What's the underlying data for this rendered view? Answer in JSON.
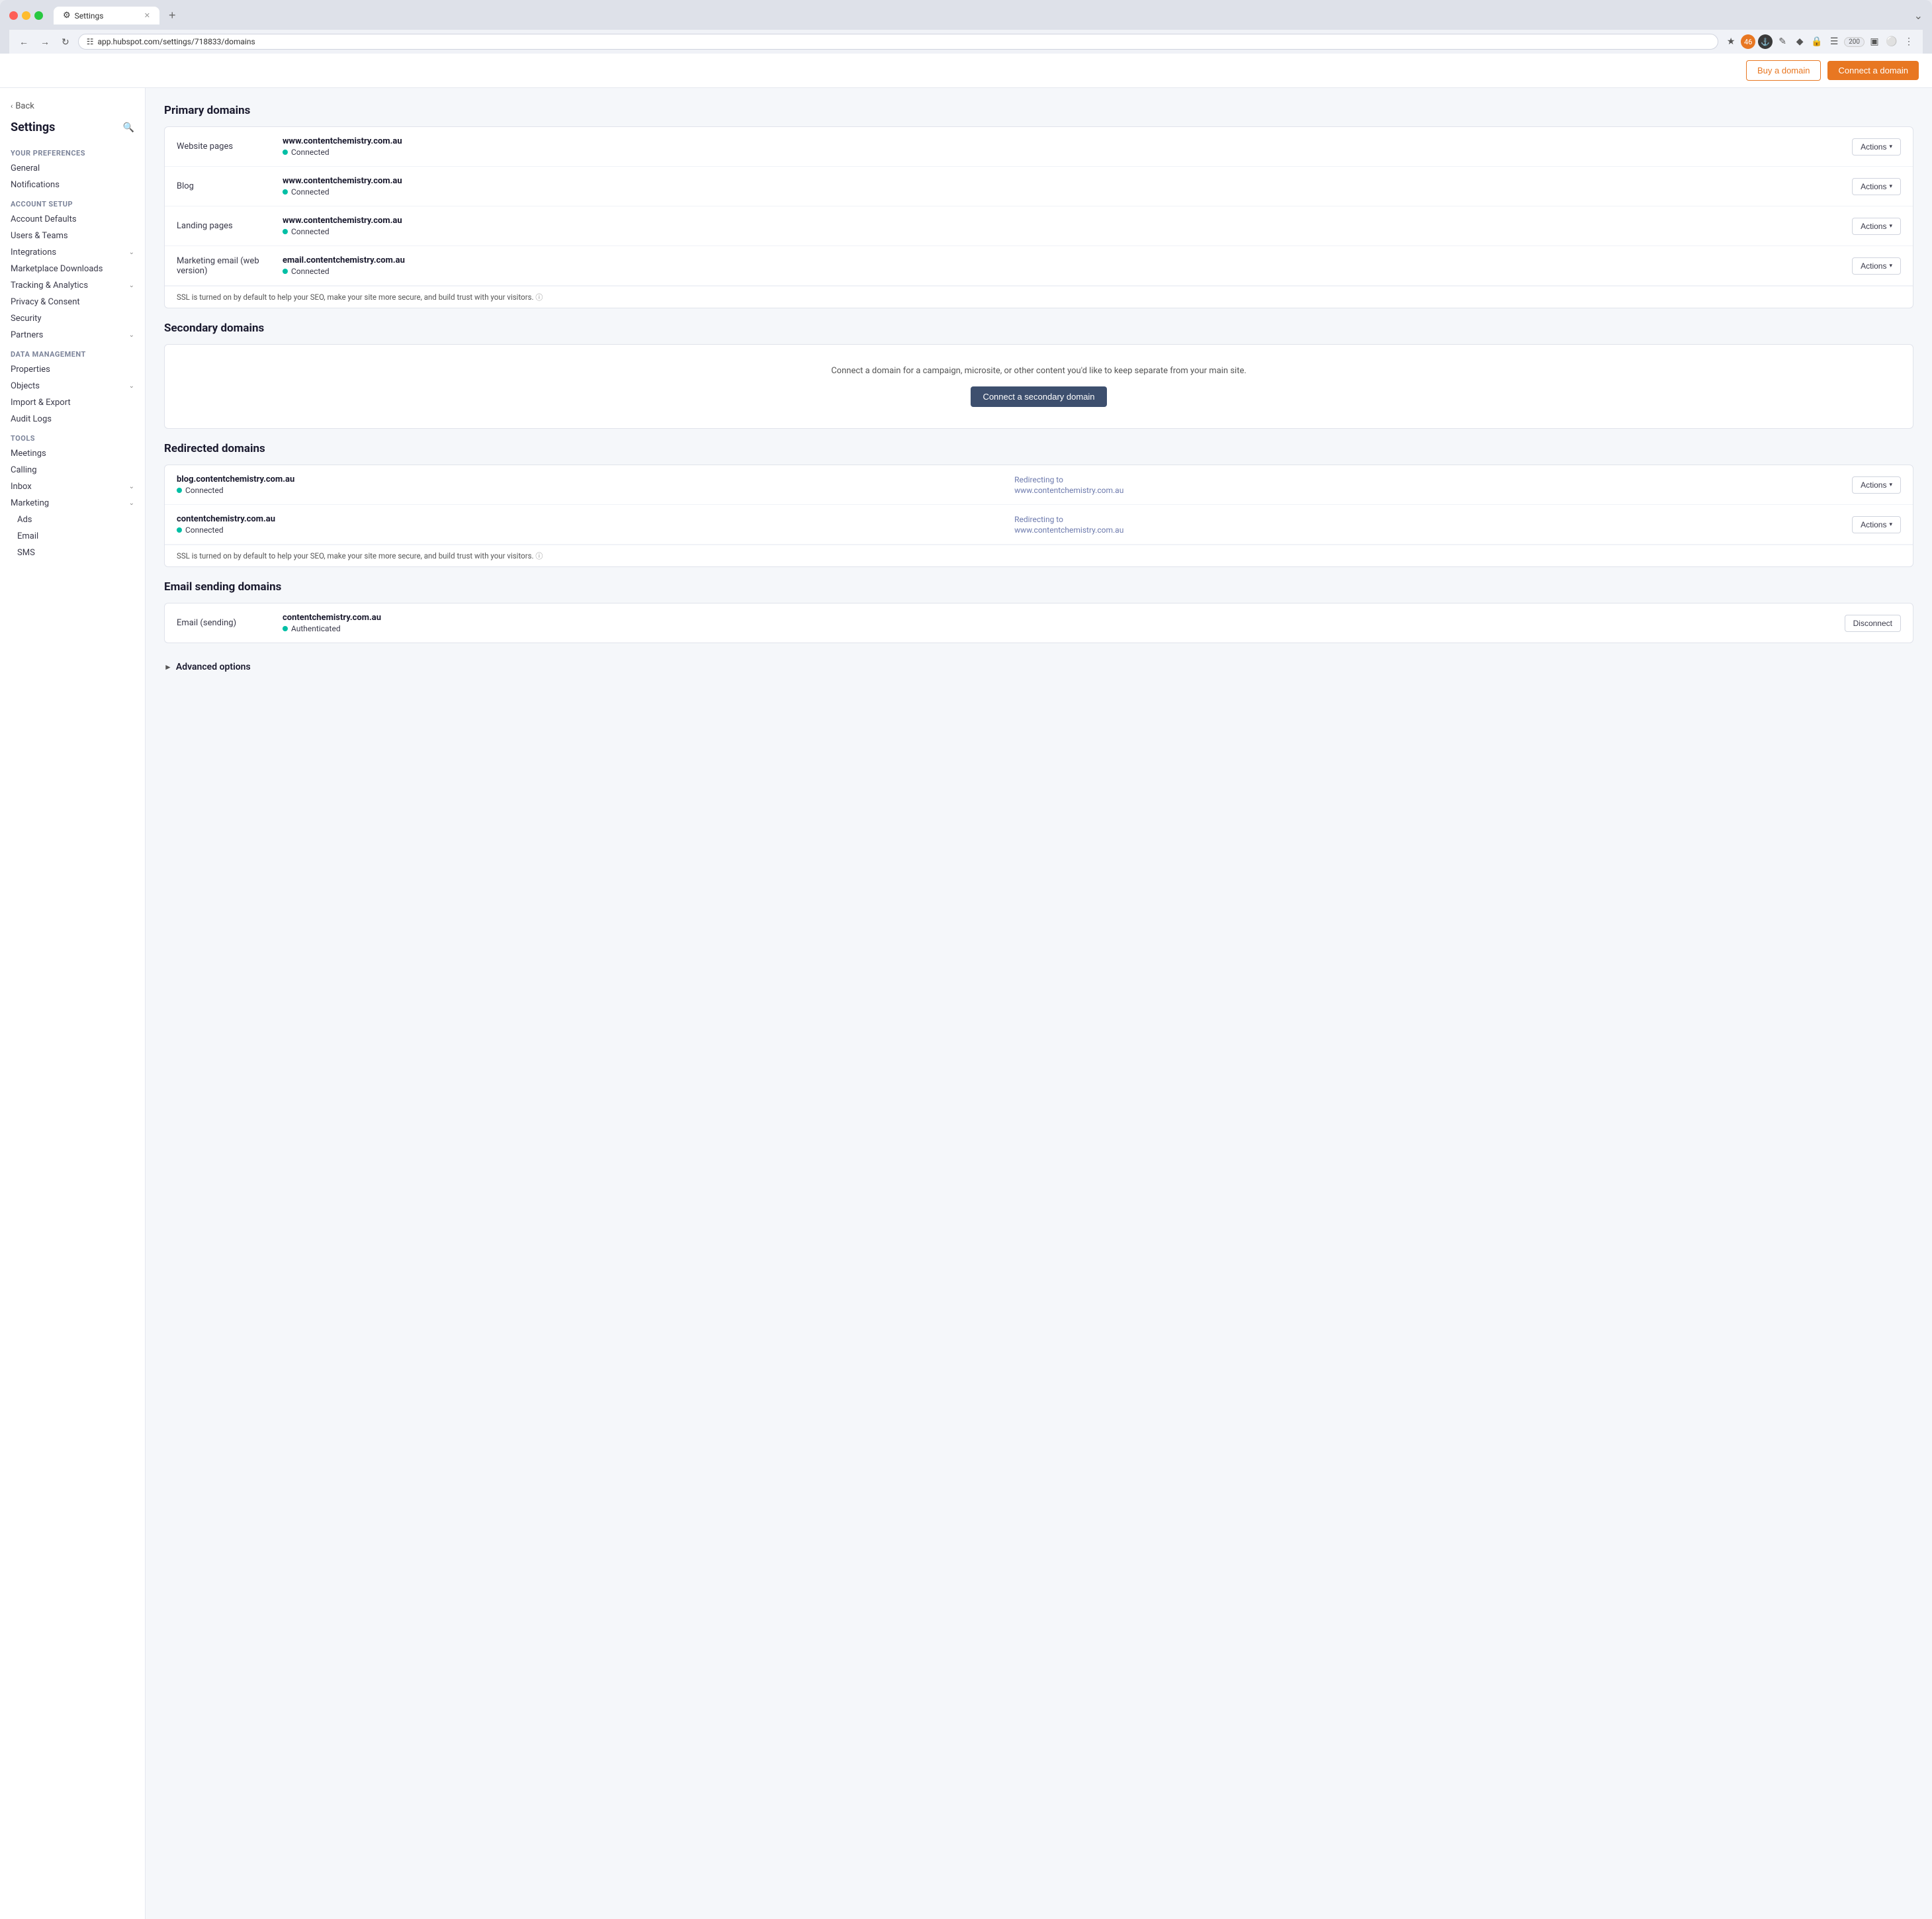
{
  "browser": {
    "tab_label": "Settings",
    "tab_favicon": "⚙",
    "url": "app.hubspot.com/settings/718833/domains",
    "new_tab_icon": "+",
    "close_icon": "✕",
    "chevron_down": "⌄"
  },
  "header": {
    "buy_domain_label": "Buy a domain",
    "connect_domain_label": "Connect a domain"
  },
  "sidebar": {
    "back_label": "Back",
    "title": "Settings",
    "sections": [
      {
        "label": "Your Preferences",
        "items": [
          {
            "label": "General",
            "sub": false
          },
          {
            "label": "Notifications",
            "sub": false
          }
        ]
      },
      {
        "label": "Account Setup",
        "items": [
          {
            "label": "Account Defaults",
            "sub": false
          },
          {
            "label": "Users & Teams",
            "sub": false
          },
          {
            "label": "Integrations",
            "sub": false,
            "caret": true
          },
          {
            "label": "Marketplace Downloads",
            "sub": false
          },
          {
            "label": "Tracking & Analytics",
            "sub": false,
            "caret": true
          },
          {
            "label": "Privacy & Consent",
            "sub": false
          },
          {
            "label": "Security",
            "sub": false
          },
          {
            "label": "Partners",
            "sub": false,
            "caret": true
          }
        ]
      },
      {
        "label": "Data Management",
        "items": [
          {
            "label": "Properties",
            "sub": false
          },
          {
            "label": "Objects",
            "sub": false,
            "caret": true
          },
          {
            "label": "Import & Export",
            "sub": false
          },
          {
            "label": "Audit Logs",
            "sub": false
          }
        ]
      },
      {
        "label": "Tools",
        "items": [
          {
            "label": "Meetings",
            "sub": false
          },
          {
            "label": "Calling",
            "sub": false
          },
          {
            "label": "Inbox",
            "sub": false,
            "caret": true
          },
          {
            "label": "Marketing",
            "sub": false,
            "caret": true
          },
          {
            "label": "Ads",
            "sub": true
          },
          {
            "label": "Email",
            "sub": true
          },
          {
            "label": "SMS",
            "sub": true
          }
        ]
      }
    ]
  },
  "main": {
    "primary_domains": {
      "section_title": "Primary domains",
      "rows": [
        {
          "type": "Website pages",
          "domain": "www.contentchemistry.com.au",
          "status": "Connected",
          "actions_label": "Actions"
        },
        {
          "type": "Blog",
          "domain": "www.contentchemistry.com.au",
          "status": "Connected",
          "actions_label": "Actions"
        },
        {
          "type": "Landing pages",
          "domain": "www.contentchemistry.com.au",
          "status": "Connected",
          "actions_label": "Actions"
        },
        {
          "type": "Marketing email (web version)",
          "domain": "email.contentchemistry.com.au",
          "status": "Connected",
          "actions_label": "Actions"
        }
      ],
      "ssl_notice": "SSL is turned on by default to help your SEO, make your site more secure, and build trust with your visitors."
    },
    "secondary_domains": {
      "section_title": "Secondary domains",
      "empty_message": "Connect a domain for a campaign, microsite, or other content you'd like to keep separate from your main site.",
      "connect_button_label": "Connect a secondary domain"
    },
    "redirected_domains": {
      "section_title": "Redirected domains",
      "rows": [
        {
          "domain": "blog.contentchemistry.com.au",
          "status": "Connected",
          "redirect_label": "Redirecting to",
          "redirect_url": "www.contentchemistry.-\ncom.au",
          "actions_label": "Actions"
        },
        {
          "domain": "contentchemistry.com.au",
          "status": "Connected",
          "redirect_label": "Redirecting to",
          "redirect_url": "www.contentchemistry.-\ncom.au",
          "actions_label": "Actions"
        }
      ],
      "ssl_notice": "SSL is turned on by default to help your SEO, make your site more secure, and build trust with your visitors."
    },
    "email_sending_domains": {
      "section_title": "Email sending domains",
      "rows": [
        {
          "type": "Email (sending)",
          "domain": "contentchemistry.com.au",
          "status": "Authenticated",
          "disconnect_label": "Disconnect"
        }
      ]
    },
    "advanced_options": {
      "label": "Advanced options"
    }
  }
}
